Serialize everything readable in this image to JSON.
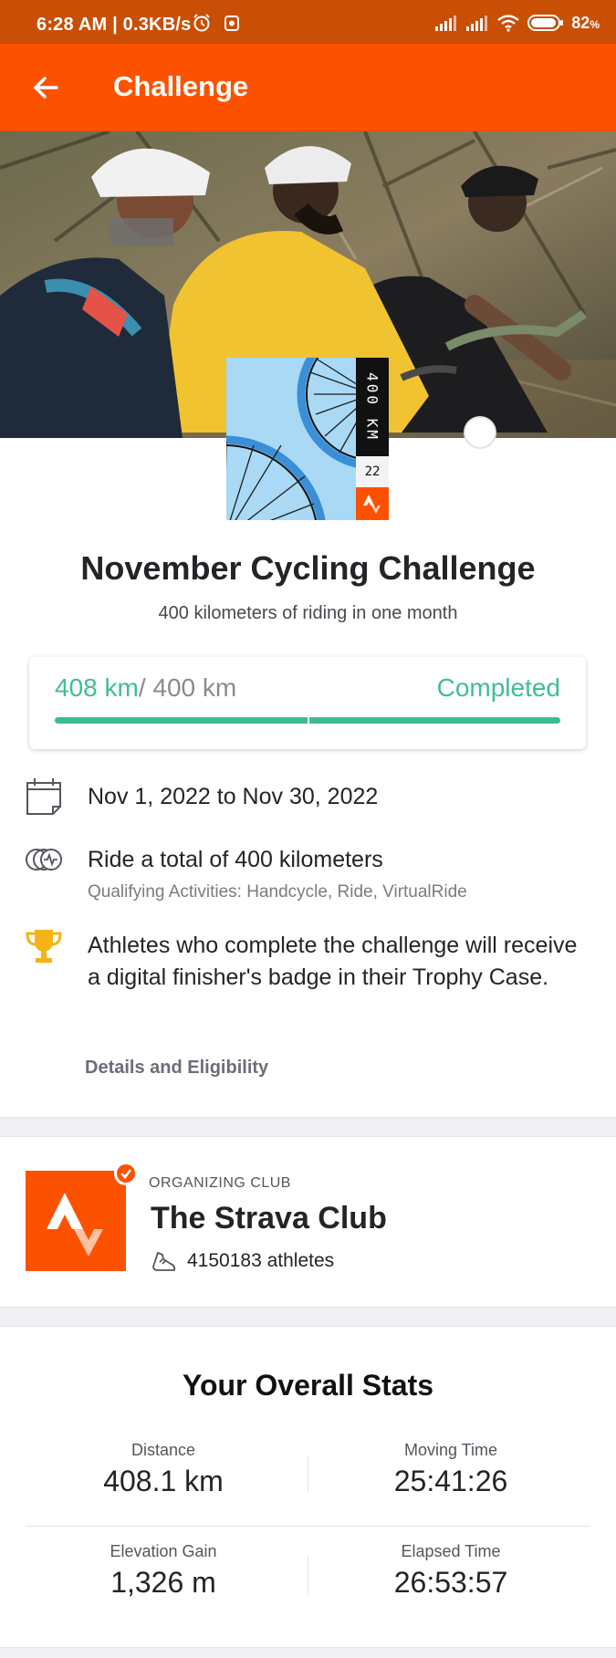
{
  "status_bar": {
    "time": "6:28 AM | 0.3KB/s",
    "battery": "82",
    "battery_unit": "%"
  },
  "app_bar": {
    "title": "Challenge",
    "back_icon": "arrow-left-icon"
  },
  "badge": {
    "distance": "400 KM",
    "year": "22"
  },
  "challenge": {
    "title": "November Cycling Challenge",
    "subtitle": "400 kilometers of riding in one month"
  },
  "progress": {
    "current": "408 km",
    "target": "/ 400 km",
    "status": "Completed",
    "fraction": 1.0,
    "color": "#3dbd8e"
  },
  "details": {
    "dates": "Nov 1, 2022 to Nov 30, 2022",
    "goal": "Ride a total of 400 kilometers",
    "qualifying": "Qualifying Activities: Handcycle, Ride, VirtualRide",
    "reward": "Athletes who complete the challenge will receive a digital finisher's badge in their Trophy Case.",
    "link_label": "Details and Eligibility",
    "icons": [
      "calendar-icon",
      "activity-rings-icon",
      "trophy-icon"
    ]
  },
  "club": {
    "kicker": "ORGANIZING CLUB",
    "name": "The Strava Club",
    "members": "4150183 athletes",
    "brand_color": "#fc5200"
  },
  "stats": {
    "title": "Your Overall Stats",
    "items": [
      {
        "label": "Distance",
        "value": "408.1 km"
      },
      {
        "label": "Moving Time",
        "value": "25:41:26"
      },
      {
        "label": "Elevation Gain",
        "value": "1,326 m"
      },
      {
        "label": "Elapsed Time",
        "value": "26:53:57"
      }
    ]
  }
}
